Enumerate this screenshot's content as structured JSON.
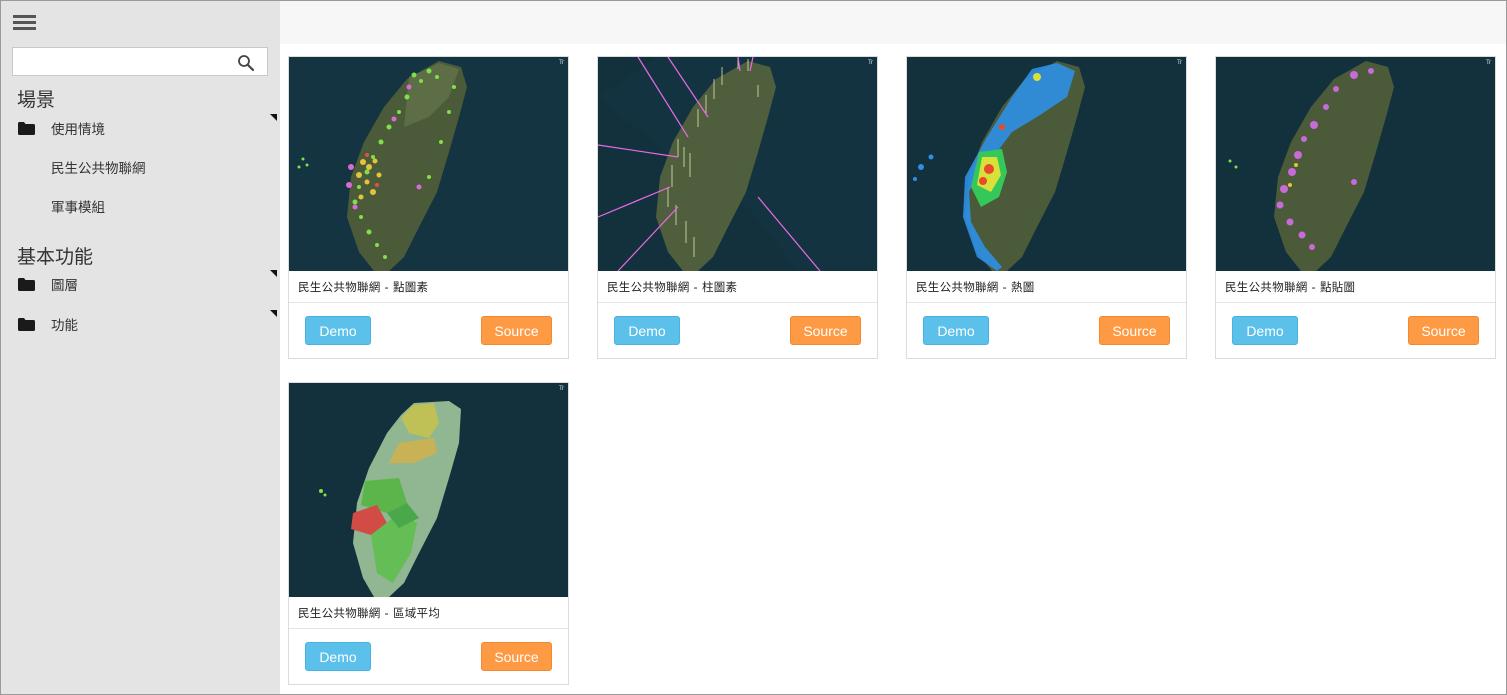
{
  "sidebar": {
    "search": {
      "placeholder": "",
      "value": ""
    },
    "sections": [
      {
        "title": "場景"
      },
      {
        "title": "基本功能"
      }
    ],
    "items": [
      {
        "label": "使用情境"
      },
      {
        "label": "民生公共物聯網"
      },
      {
        "label": "軍事模組"
      },
      {
        "label": "圖層"
      },
      {
        "label": "功能"
      }
    ]
  },
  "cards": [
    {
      "caption": "民生公共物聯網 - 點圖素",
      "demo_label": "Demo",
      "source_label": "Source"
    },
    {
      "caption": "民生公共物聯網 - 柱圖素",
      "demo_label": "Demo",
      "source_label": "Source"
    },
    {
      "caption": "民生公共物聯網 - 熱圖",
      "demo_label": "Demo",
      "source_label": "Source"
    },
    {
      "caption": "民生公共物聯網 - 點貼圖",
      "demo_label": "Demo",
      "source_label": "Source"
    },
    {
      "caption": "民生公共物聯網 - 區域平均",
      "demo_label": "Demo",
      "source_label": "Source"
    }
  ],
  "colors": {
    "demo_button": "#5bc0ea",
    "source_button": "#ff9a44",
    "sidebar_bg": "#e4e4e4",
    "map_ocean": "#112a36"
  },
  "icons": {
    "menu": "hamburger-icon",
    "search": "search-icon",
    "folder": "folder-icon",
    "caret": "caret-icon"
  }
}
